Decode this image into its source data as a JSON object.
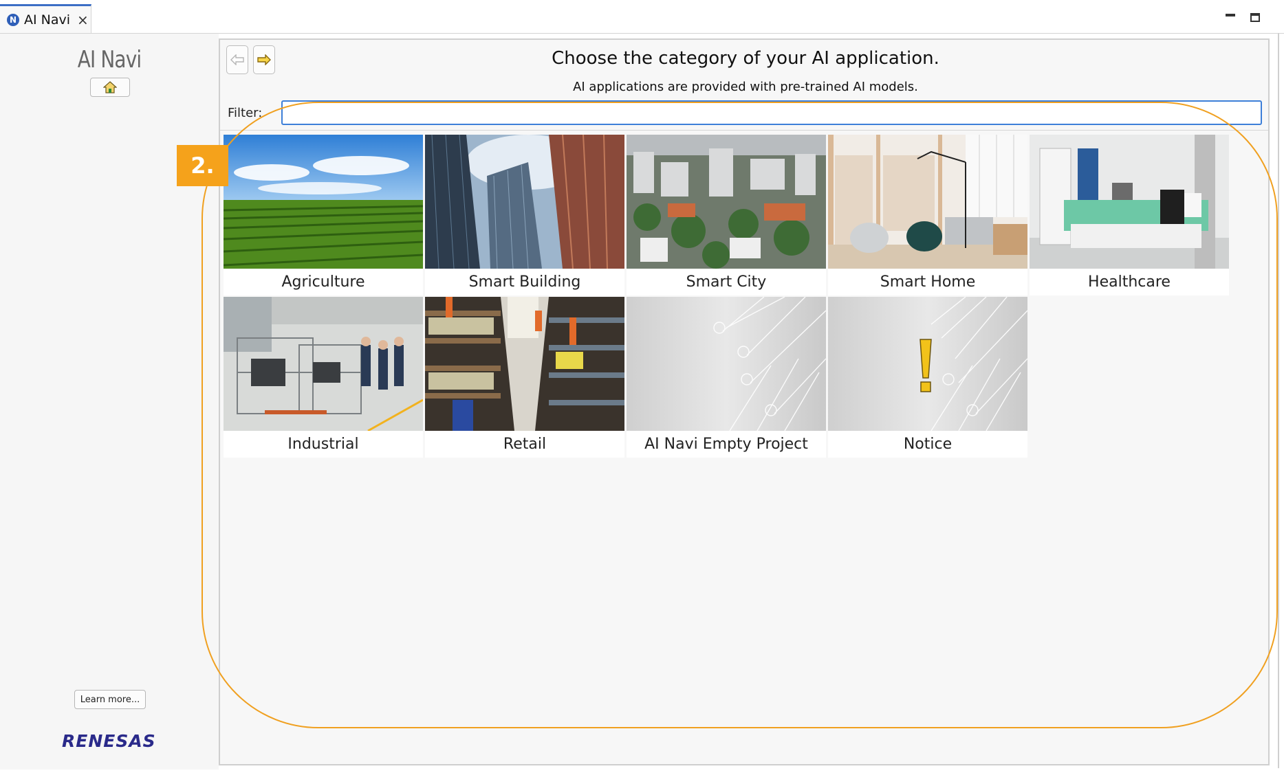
{
  "tab": {
    "label": "AI Navi",
    "icon_letter": "N"
  },
  "sidebar": {
    "title": "AI Navi",
    "learn_more": "Learn more...",
    "logo_text": "RENESAS"
  },
  "main": {
    "heading": "Choose the category of your AI application.",
    "subheading": "AI applications are provided with pre-trained AI models.",
    "filter_label": "Filter:",
    "filter_value": "",
    "categories": [
      {
        "label": "Agriculture"
      },
      {
        "label": "Smart Building"
      },
      {
        "label": "Smart City"
      },
      {
        "label": "Smart Home"
      },
      {
        "label": "Healthcare"
      },
      {
        "label": "Industrial"
      },
      {
        "label": "Retail"
      },
      {
        "label": "AI Navi Empty Project"
      },
      {
        "label": "Notice"
      }
    ]
  },
  "annotation": {
    "badge": "2."
  },
  "colors": {
    "accent": "#f5a21b",
    "tab_border": "#3b6ec5",
    "filter_border": "#3d7fd8",
    "logo": "#2a2a8a"
  }
}
